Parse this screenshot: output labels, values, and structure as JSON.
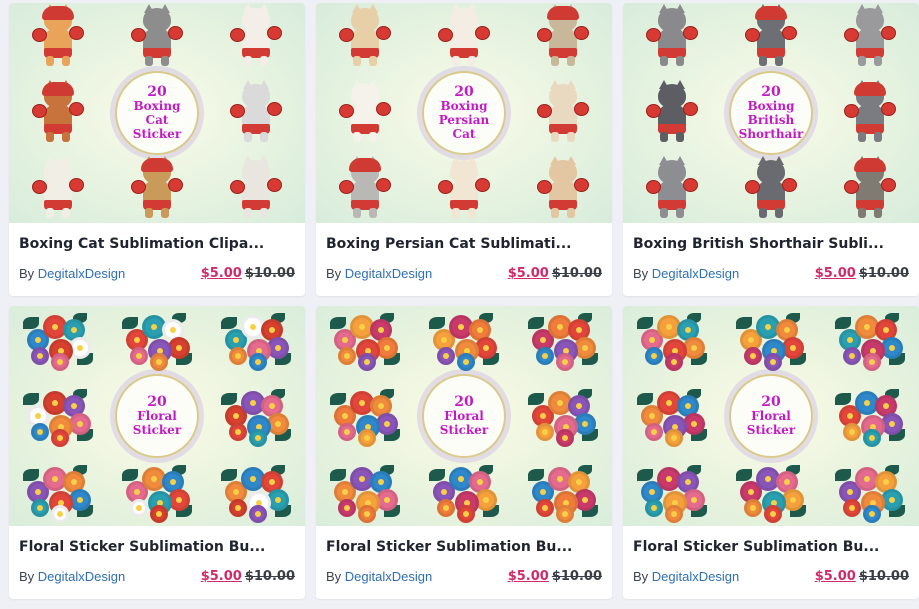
{
  "products": [
    {
      "theme": "boxing",
      "badge": [
        "20",
        "Boxing",
        "Cat",
        "Sticker"
      ],
      "title": "Boxing Cat Sublimation Clipa...",
      "by_label": "By",
      "author": "DegitalxDesign",
      "price": "$5.00",
      "original_price": "$10.00",
      "cat_palette": [
        "#e9a45a",
        "#8d8d8d",
        "#f3efe8",
        "#c9733c",
        "#d9dad9",
        "#f1eee6",
        "#c99a5a",
        "#e8e6df"
      ]
    },
    {
      "theme": "boxing",
      "badge": [
        "20",
        "Boxing",
        "Persian",
        "Cat"
      ],
      "title": "Boxing Persian Cat Sublimati...",
      "by_label": "By",
      "author": "DegitalxDesign",
      "price": "$5.00",
      "original_price": "$10.00",
      "cat_palette": [
        "#e7cfa8",
        "#f3ede4",
        "#c9b79a",
        "#f5f1eb",
        "#e8d9c0",
        "#b9b8b5",
        "#f0e6d3",
        "#e3c7a2"
      ]
    },
    {
      "theme": "boxing",
      "badge": [
        "20",
        "Boxing",
        "British",
        "Shorthair"
      ],
      "title": "Boxing British Shorthair Subli...",
      "by_label": "By",
      "author": "DegitalxDesign",
      "price": "$5.00",
      "original_price": "$10.00",
      "cat_palette": [
        "#8a8a8c",
        "#6e6f74",
        "#9a9a9d",
        "#5d5e63",
        "#7b7c81",
        "#8d8e92",
        "#6a6b70",
        "#7f7b72"
      ]
    },
    {
      "theme": "floral",
      "badge": [
        "20",
        "Floral",
        "Sticker"
      ],
      "title": "Floral Sticker Sublimation Bu...",
      "by_label": "By",
      "author": "DegitalxDesign",
      "price": "$5.00",
      "original_price": "$10.00",
      "flower_palette": [
        "#8a55b8",
        "#e56b8e",
        "#f08a3c",
        "#2f88c9",
        "#e2463a",
        "#2a9fb0",
        "#ffffff",
        "#d6402f"
      ]
    },
    {
      "theme": "floral",
      "badge": [
        "20",
        "Floral",
        "Sticker"
      ],
      "title": "Floral Sticker Sublimation Bu...",
      "by_label": "By",
      "author": "DegitalxDesign",
      "price": "$5.00",
      "original_price": "$10.00",
      "flower_palette": [
        "#e2463a",
        "#f08a3c",
        "#8a55b8",
        "#2f88c9",
        "#e56b8e",
        "#f5a03c",
        "#c93a6b",
        "#ef7c3a"
      ]
    },
    {
      "theme": "floral",
      "badge": [
        "20",
        "Floral",
        "Sticker"
      ],
      "title": "Floral Sticker Sublimation Bu...",
      "by_label": "By",
      "author": "DegitalxDesign",
      "price": "$5.00",
      "original_price": "$10.00",
      "flower_palette": [
        "#f08a3c",
        "#e2463a",
        "#2f88c9",
        "#c93a6b",
        "#8a55b8",
        "#e56b8e",
        "#f5a03c",
        "#2a9fb0"
      ]
    }
  ]
}
